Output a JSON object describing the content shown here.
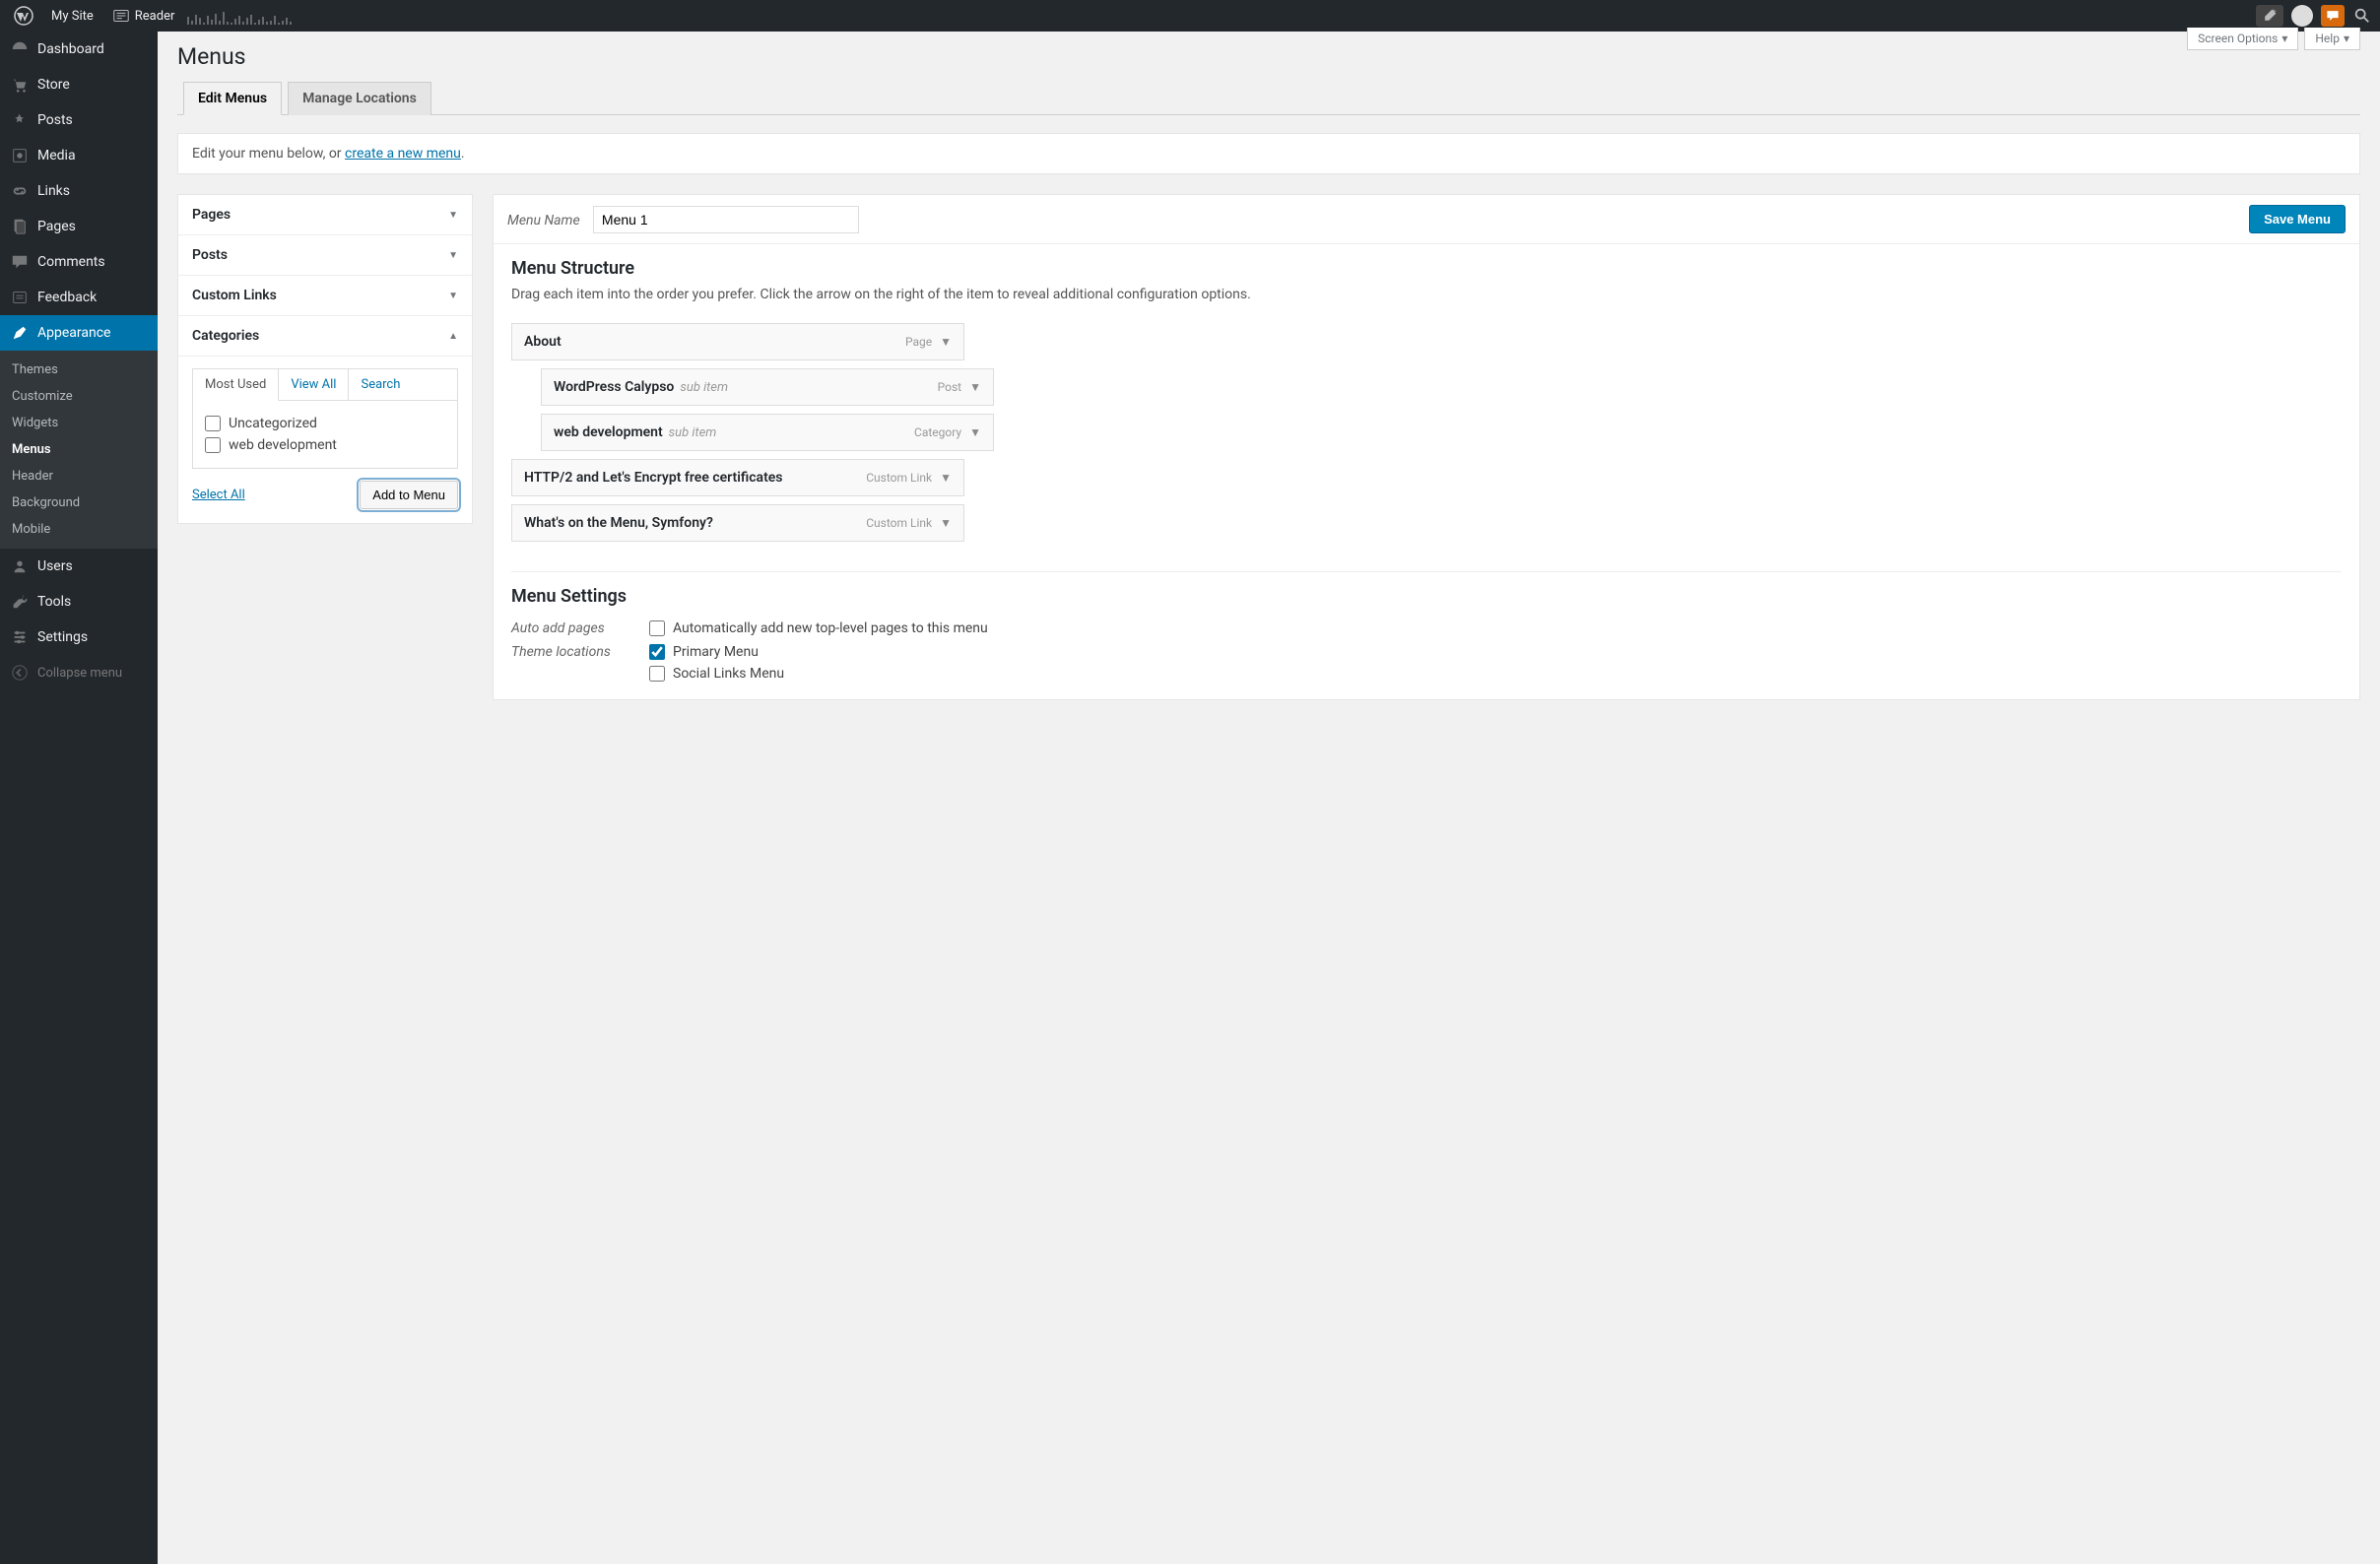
{
  "toolbar": {
    "mysite": "My Site",
    "reader": "Reader"
  },
  "sidebar": {
    "items": [
      {
        "label": "Dashboard"
      },
      {
        "label": "Store"
      },
      {
        "label": "Posts"
      },
      {
        "label": "Media"
      },
      {
        "label": "Links"
      },
      {
        "label": "Pages"
      },
      {
        "label": "Comments"
      },
      {
        "label": "Feedback"
      },
      {
        "label": "Appearance"
      },
      {
        "label": "Users"
      },
      {
        "label": "Tools"
      },
      {
        "label": "Settings"
      }
    ],
    "submenu": [
      {
        "label": "Themes"
      },
      {
        "label": "Customize"
      },
      {
        "label": "Widgets"
      },
      {
        "label": "Menus"
      },
      {
        "label": "Header"
      },
      {
        "label": "Background"
      },
      {
        "label": "Mobile"
      }
    ],
    "collapse": "Collapse menu"
  },
  "screen": {
    "options": "Screen Options",
    "help": "Help"
  },
  "page": {
    "title": "Menus",
    "tabs": [
      "Edit Menus",
      "Manage Locations"
    ],
    "notice_pre": "Edit your menu below, or ",
    "notice_link": "create a new menu",
    "notice_post": "."
  },
  "metaboxes": {
    "headers": [
      "Pages",
      "Posts",
      "Custom Links",
      "Categories"
    ],
    "cat_tabs": [
      "Most Used",
      "View All",
      "Search"
    ],
    "cat_items": [
      "Uncategorized",
      "web development"
    ],
    "select_all": "Select All",
    "add_btn": "Add to Menu"
  },
  "menu": {
    "name_label": "Menu Name",
    "name_value": "Menu 1",
    "save": "Save Menu",
    "structure_title": "Menu Structure",
    "structure_desc": "Drag each item into the order you prefer. Click the arrow on the right of the item to reveal additional configuration options.",
    "items": [
      {
        "title": "About",
        "type": "Page",
        "depth": 0
      },
      {
        "title": "WordPress Calypso",
        "sub": "sub item",
        "type": "Post",
        "depth": 1
      },
      {
        "title": "web development",
        "sub": "sub item",
        "type": "Category",
        "depth": 1
      },
      {
        "title": "HTTP/2 and Let's Encrypt free certificates",
        "type": "Custom Link",
        "depth": 0
      },
      {
        "title": "What's on the Menu, Symfony?",
        "type": "Custom Link",
        "depth": 0
      }
    ],
    "settings_title": "Menu Settings",
    "auto_label": "Auto add pages",
    "auto_opt": "Automatically add new top-level pages to this menu",
    "loc_label": "Theme locations",
    "loc_opts": [
      {
        "label": "Primary Menu",
        "checked": true
      },
      {
        "label": "Social Links Menu",
        "checked": false
      }
    ]
  }
}
